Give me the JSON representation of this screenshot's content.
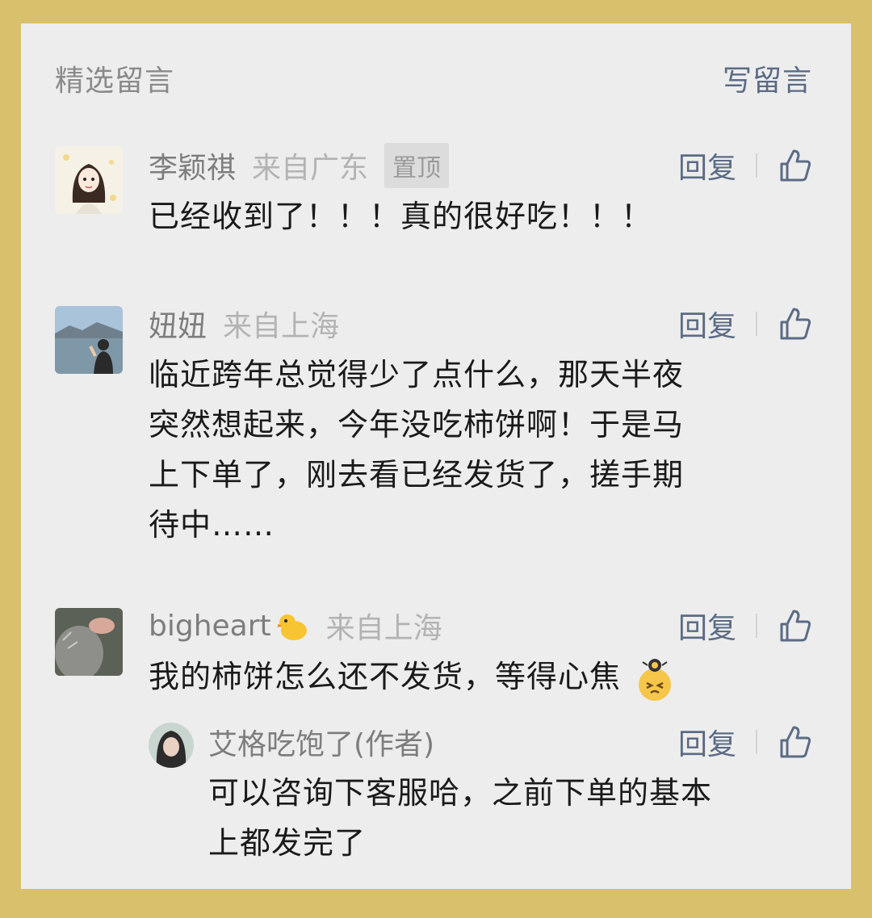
{
  "header": {
    "title": "精选留言",
    "write_label": "写留言"
  },
  "comments": [
    {
      "name": "李颖祺",
      "from": "来自广东",
      "pin": "置顶",
      "reply_label": "回复",
      "lines": [
        "已经收到了！！！真的很好吃！！！"
      ]
    },
    {
      "name": "妞妞",
      "from": "来自上海",
      "reply_label": "回复",
      "lines": [
        "临近跨年总觉得少了点什么，那天半夜",
        "突然想起来，今年没吃柿饼啊！于是马",
        "上下单了，刚去看已经发货了，搓手期",
        "待中……"
      ]
    },
    {
      "name": "bigheart",
      "from": "来自上海",
      "reply_label": "回复",
      "lines": [
        "我的柿饼怎么还不发货，等得心焦"
      ]
    }
  ],
  "author_reply": {
    "name": "艾格吃饱了(作者)",
    "reply_label": "回复",
    "lines": [
      "可以咨询下客服哈，之前下单的基本",
      "上都发完了"
    ]
  },
  "colors": {
    "frame": "#d9c06c",
    "panel": "#ededed",
    "link": "#5b6b85",
    "muted": "#b3b3b3"
  }
}
